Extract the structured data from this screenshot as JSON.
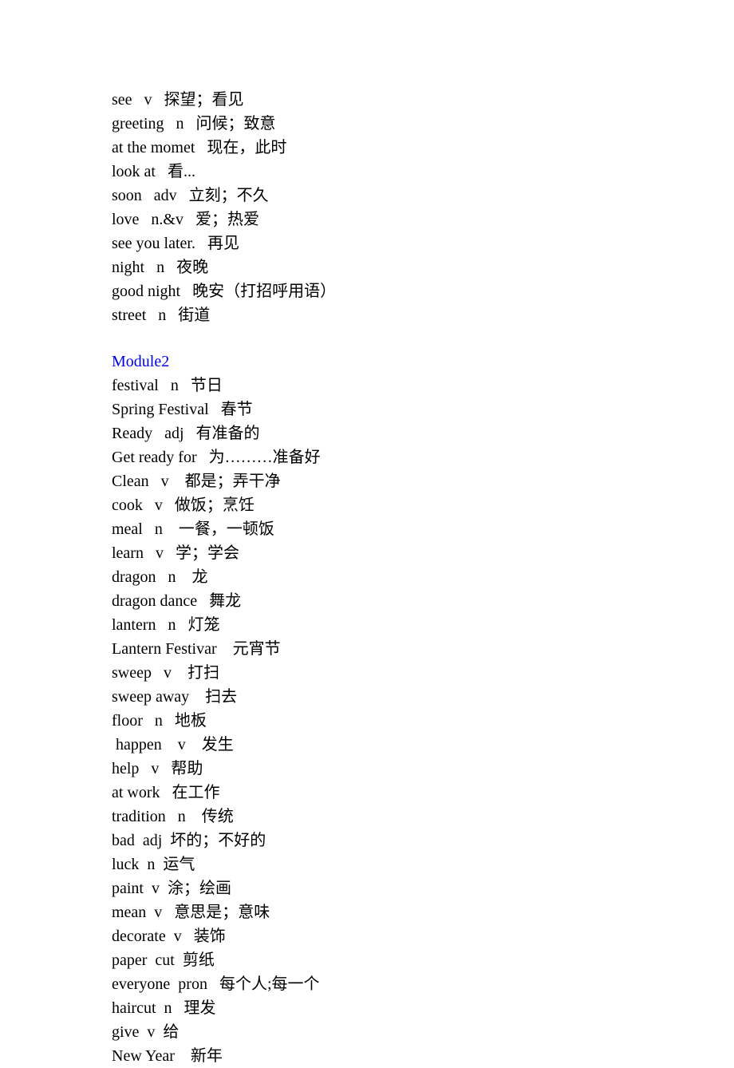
{
  "block1": [
    "see   v   探望；看见",
    "greeting   n   问候；致意",
    "at the momet   现在，此时",
    "look at   看...",
    "soon   adv   立刻；不久",
    "love   n.&v   爱；热爱",
    "see you later.   再见",
    "night   n   夜晚",
    "good night   晚安（打招呼用语）",
    "street   n   街道"
  ],
  "module2_heading": "Module2",
  "block2": [
    "festival   n   节日",
    "Spring Festival   春节",
    "Ready   adj   有准备的",
    "Get ready for   为………准备好",
    "Clean   v    都是；弄干净",
    "cook   v   做饭；烹饪",
    "meal   n    一餐，一顿饭",
    "learn   v   学；学会",
    "dragon   n    龙",
    "dragon dance   舞龙",
    "lantern   n   灯笼",
    "Lantern Festivar    元宵节",
    "sweep   v    打扫",
    "sweep away    扫去",
    "floor   n   地板",
    " happen    v    发生",
    "help   v   帮助",
    "at work   在工作",
    "tradition   n    传统",
    "bad  adj  坏的；不好的",
    "luck  n  运气",
    "paint  v  涂；绘画",
    "mean  v   意思是；意味",
    "decorate  v   装饰",
    "paper  cut  剪纸",
    "everyone  pron   每个人;每一个",
    "haircut  n   理发",
    "give  v  给",
    "New Year    新年"
  ]
}
